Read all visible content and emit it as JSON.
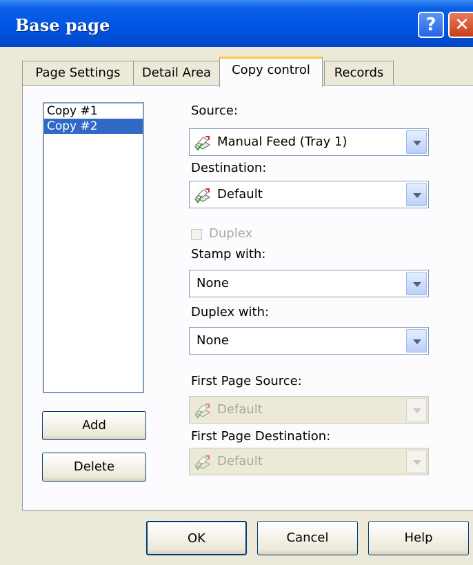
{
  "window": {
    "title": "Base page"
  },
  "tabs": [
    "Page Settings",
    "Detail Area",
    "Copy control",
    "Records"
  ],
  "copies": [
    "Copy #1",
    "Copy #2"
  ],
  "buttons": {
    "add": "Add",
    "delete": "Delete"
  },
  "fields": {
    "source_label": "Source:",
    "source_value": "Manual Feed (Tray 1)",
    "destination_label": "Destination:",
    "destination_value": "Default",
    "duplex_label": "Duplex",
    "stamp_label": "Stamp with:",
    "stamp_value": "None",
    "duplex_with_label": "Duplex with:",
    "duplex_with_value": "None",
    "first_source_label": "First Page Source:",
    "first_source_value": "Default",
    "first_destination_label": "First Page Destination:",
    "first_destination_value": "Default"
  },
  "footer": {
    "ok": "OK",
    "cancel": "Cancel",
    "help": "Help"
  },
  "icons": {
    "help": "help-icon",
    "close": "close-icon",
    "tray": "printer-tray-icon"
  },
  "colors": {
    "titlebar": "#0054e3",
    "selection": "#316ac5",
    "tab_highlight": "#ffc83c"
  }
}
